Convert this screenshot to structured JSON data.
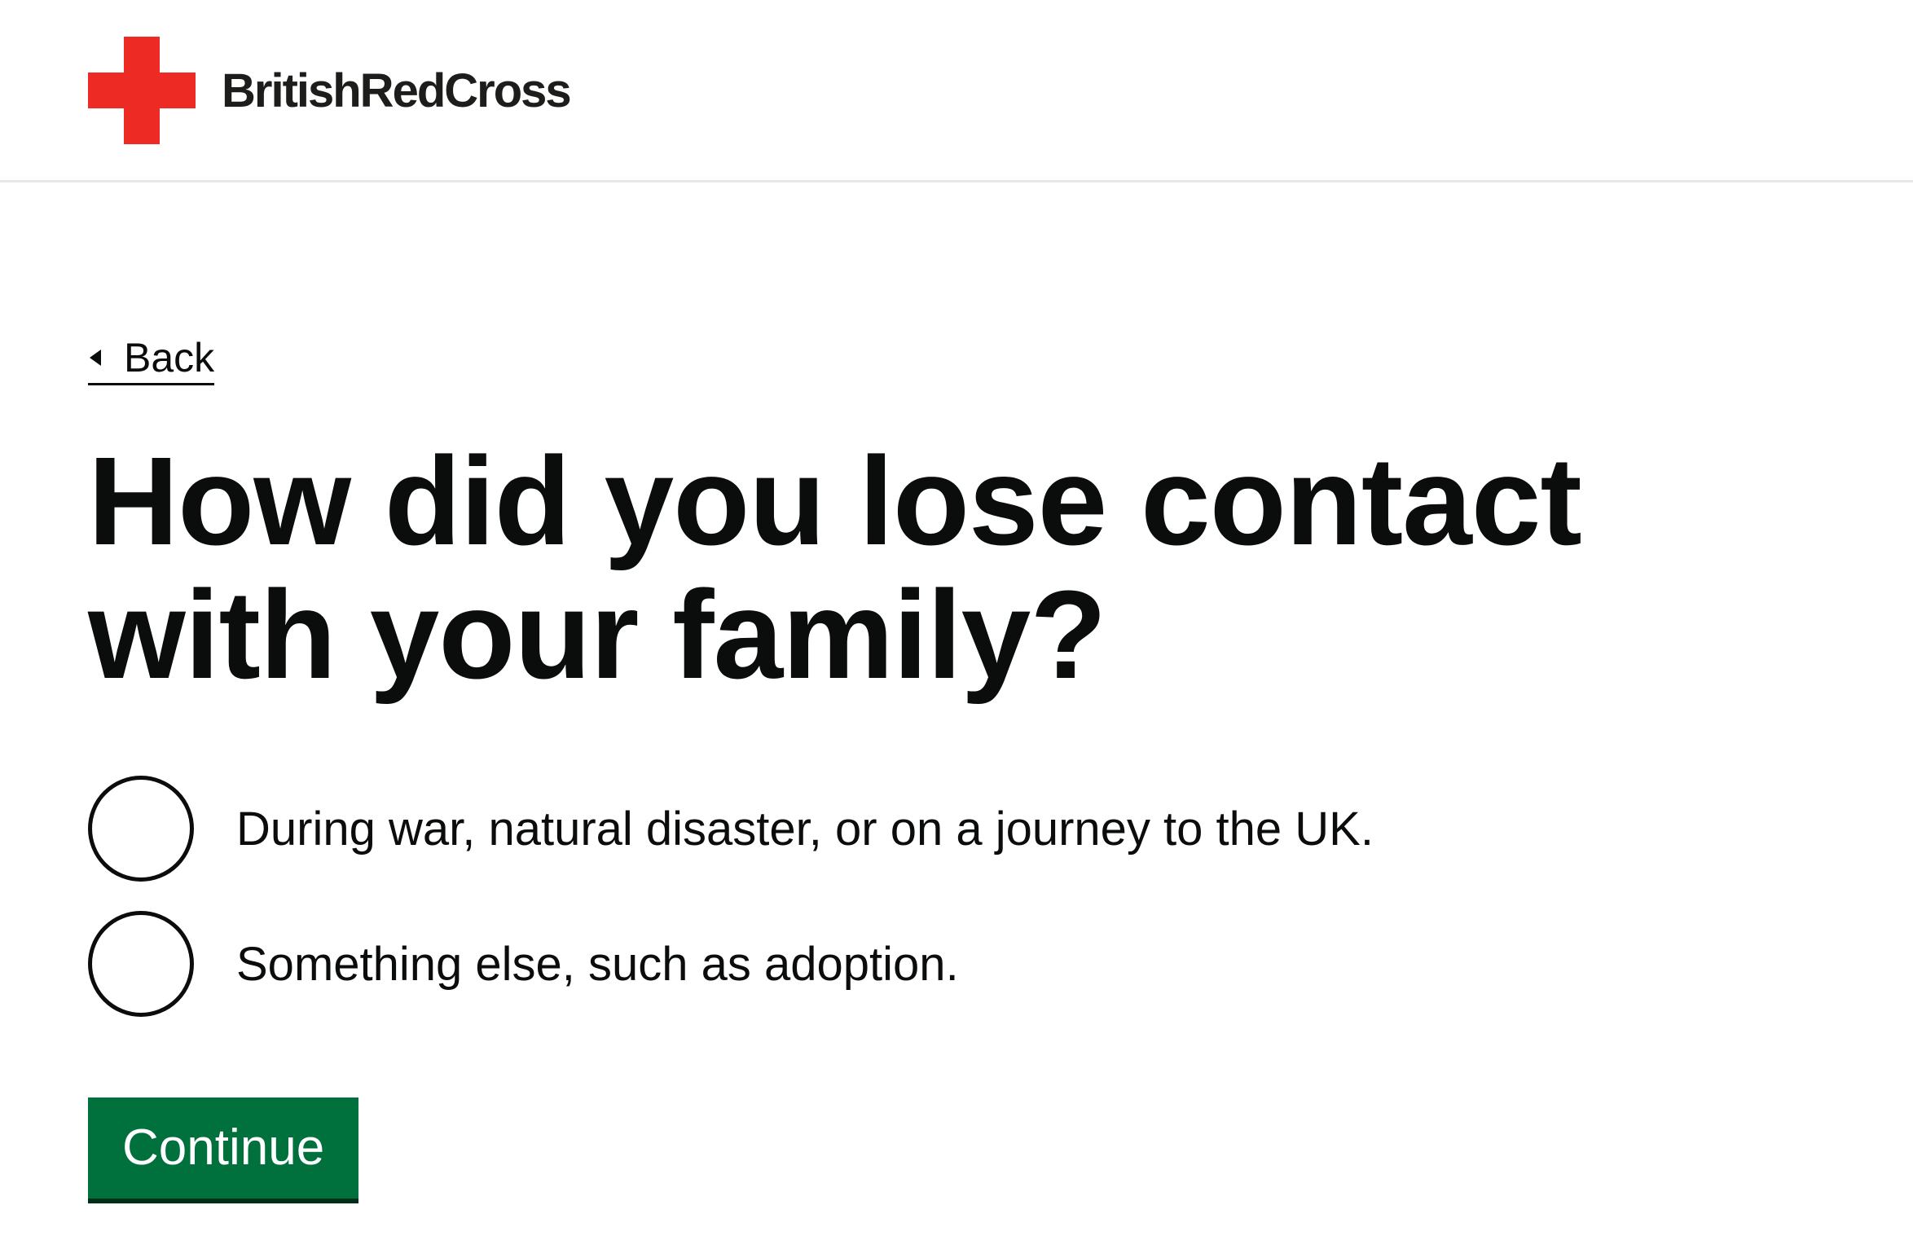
{
  "header": {
    "brand_name": "BritishRedCross",
    "logo_icon": "red-cross-icon",
    "logo_color": "#ee2a24"
  },
  "navigation": {
    "back_label": "Back",
    "back_icon": "triangle-left-icon"
  },
  "question": {
    "title": "How did you lose contact with your family?",
    "options": [
      {
        "label": "During war, natural disaster, or on a journey to the UK.",
        "selected": false
      },
      {
        "label": "Something else, such as adoption.",
        "selected": false
      }
    ]
  },
  "actions": {
    "continue_label": "Continue",
    "continue_color": "#00703c"
  }
}
